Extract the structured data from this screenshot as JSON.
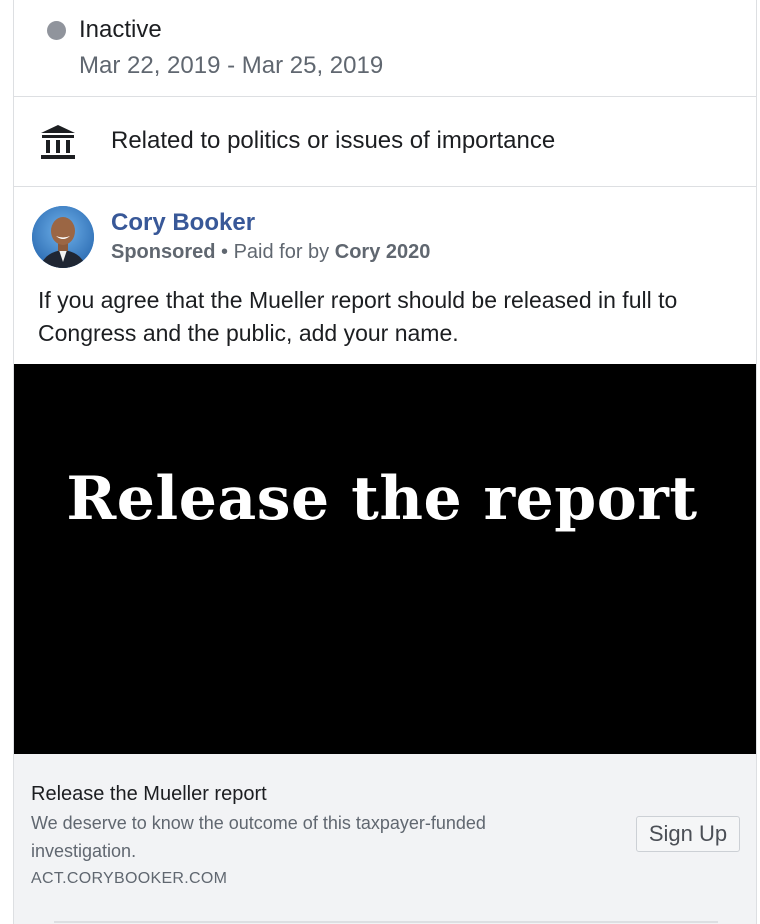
{
  "status": {
    "label": "Inactive",
    "dot_color": "#90949c",
    "date_range": "Mar 22, 2019 - Mar 25, 2019"
  },
  "category": {
    "icon": "building-icon",
    "label": "Related to politics or issues of importance"
  },
  "advertiser": {
    "name": "Cory Booker",
    "sponsored": "Sponsored",
    "separator": " • ",
    "paid_for_prefix": "Paid for by ",
    "paid_for_by": "Cory 2020",
    "avatar": "avatar-photo"
  },
  "ad": {
    "body": "If you agree that the Mueller report should be released in full to Congress and the public, add your name.",
    "creative_text": "Release the report"
  },
  "link": {
    "title": "Release the Mueller report",
    "description": "We deserve to know the outcome of this taxpayer-funded investigation.",
    "domain": "ACT.CORYBOOKER.COM",
    "cta_label": "Sign Up"
  },
  "colors": {
    "link_blue": "#385898",
    "creative_bg": "#000000"
  }
}
